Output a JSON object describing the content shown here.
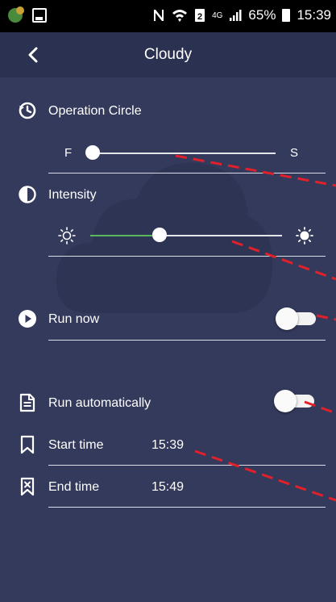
{
  "status_bar": {
    "network": "4G",
    "battery": "65%",
    "time": "15:39"
  },
  "header": {
    "title": "Cloudy"
  },
  "operation_circle": {
    "label": "Operation Circle",
    "min_label": "F",
    "max_label": "S",
    "value_fraction": 0.0
  },
  "intensity": {
    "label": "Intensity",
    "value_fraction": 0.36
  },
  "run_now": {
    "label": "Run now",
    "enabled": false
  },
  "run_automatically": {
    "label": "Run automatically",
    "enabled": false
  },
  "start_time": {
    "label": "Start time",
    "value": "15:39"
  },
  "end_time": {
    "label": "End time",
    "value": "15:49"
  },
  "colors": {
    "background": "#343a5c",
    "toolbar": "#2b3150",
    "slider_fill": "#5cb85c",
    "annotation": "#e0202a"
  }
}
